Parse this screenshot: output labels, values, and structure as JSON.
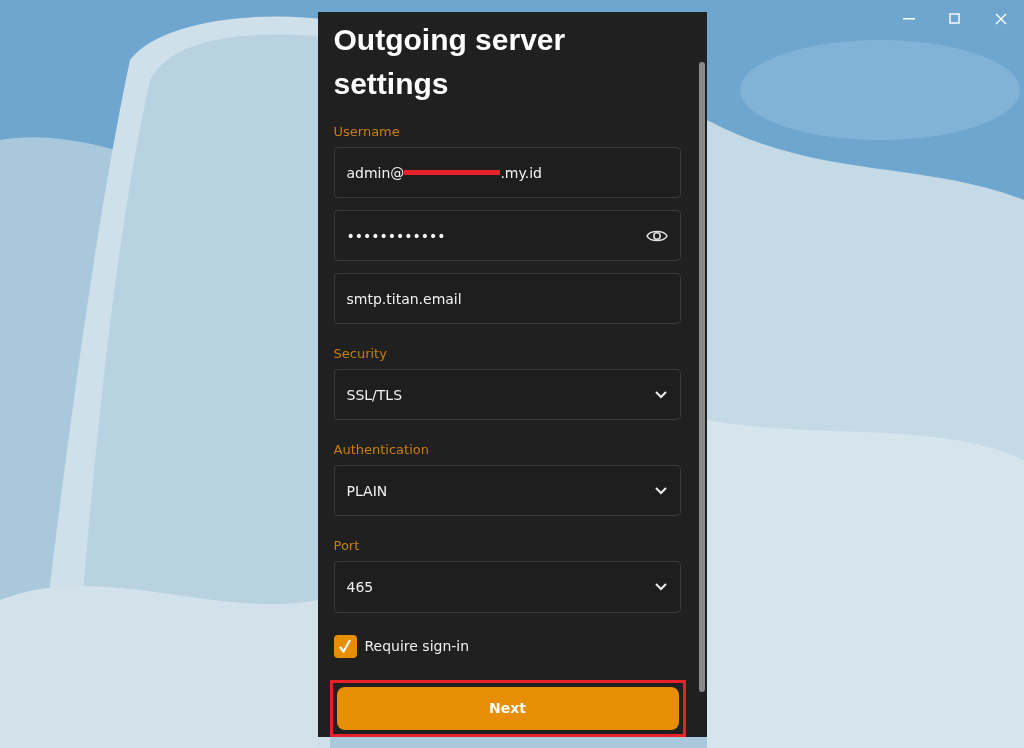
{
  "title": "Outgoing server settings",
  "fields": [
    {
      "kind": "text",
      "label": "Username",
      "value_before": "admin@",
      "redacted": true,
      "value_after": ".my.id"
    },
    {
      "kind": "password",
      "value": "••••••••••••"
    },
    {
      "kind": "text",
      "value": "smtp.titan.email"
    },
    {
      "kind": "select",
      "label": "Security",
      "value": "SSL/TLS"
    },
    {
      "kind": "select",
      "label": "Authentication",
      "value": "PLAIN"
    },
    {
      "kind": "select",
      "label": "Port",
      "value": "465"
    }
  ],
  "require_signin": {
    "label": "Require sign-in",
    "checked": true
  },
  "next_button": {
    "label": "Next",
    "highlighted": true
  }
}
